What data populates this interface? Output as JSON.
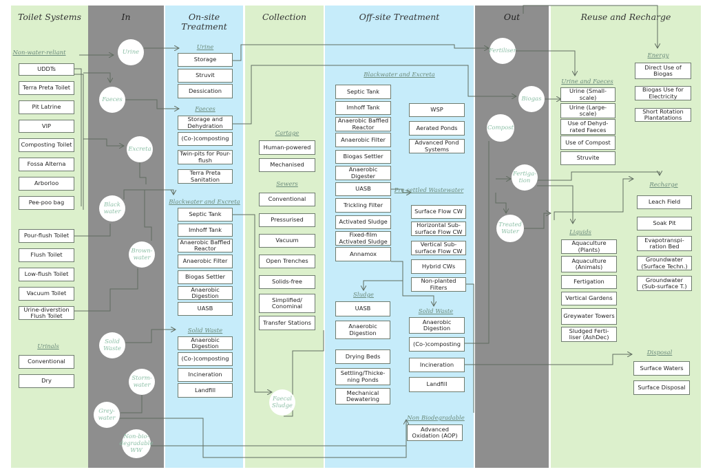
{
  "columns": [
    {
      "title": "Toilet Systems"
    },
    {
      "title": "In"
    },
    {
      "title": "On-site Treatment"
    },
    {
      "title": "Collection"
    },
    {
      "title": "Off-site Treatment"
    },
    {
      "title": "Out"
    },
    {
      "title": "Reuse and Recharge"
    }
  ],
  "groups": [
    {
      "header": "Non-water-reliant",
      "items": [
        "UDDTs",
        "Terra Preta Toilet",
        "Pit Latrine",
        "VIP",
        "Composting Toilet",
        "Fossa Alterna",
        "Arborloo",
        "Pee-poo bag"
      ]
    },
    {
      "header": "",
      "items": [
        "Pour-flush Toilet",
        "Flush Toilet",
        "Low-flush Toilet",
        "Vacuum Toilet",
        "Urine-diverstion Flush Toilet"
      ]
    },
    {
      "header": "Urinals",
      "items": [
        "Conventional",
        "Dry"
      ]
    },
    {
      "header": "Urine",
      "items": [
        "Storage",
        "Struvit",
        "Dessication"
      ]
    },
    {
      "header": "Faeces",
      "items": [
        "Storage and Dehydration",
        "(Co-)composting",
        "Twin-pits for Pour-flush",
        "Terra Preta Sanitation"
      ]
    },
    {
      "header": "Blackwater and Excreta",
      "items": [
        "Septic Tank",
        "Imhoff Tank",
        "Anaerobic Baffled Reactor",
        "Anaerobic Filter",
        "Biogas Settler",
        "Anaerobic Digestion",
        "UASB"
      ]
    },
    {
      "header": "Solid Waste",
      "items": [
        "Anaerobic Digestion",
        "(Co-)composting",
        "Incineration",
        "Landfill"
      ]
    },
    {
      "header": "Cartage",
      "items": [
        "Human-powered",
        "Mechanised"
      ]
    },
    {
      "header": "Sewers",
      "items": [
        "Conventional",
        "Pressurised",
        "Vacuum",
        "Open Trenches",
        "Solids-free",
        "Simplified/ Conominal",
        "Transfer Stations"
      ]
    },
    {
      "header": "Blackwater and Excreta",
      "items": [
        "Septic Tank",
        "Imhoff Tank",
        "Anaerobic Baffled Reactor",
        "Anaerobic Filter",
        "Biogas Settler",
        "Anaerobic Digester",
        "UASB",
        "Trickling Filter",
        "Activated Sludge",
        "Fixed-film Activated Sludge",
        "Annamox"
      ]
    },
    {
      "header": "",
      "items": [
        "WSP",
        "Aerated Ponds",
        "Advanced Pond Systems"
      ]
    },
    {
      "header": "Pre-settled Wastewater",
      "items": [
        "Surface Flow CW",
        "Horizontal Sub-surface Flow CW",
        "Vertical Sub-surface Flow CW",
        "Hybrid CWs",
        "Non-planted Filters"
      ]
    },
    {
      "header": "Sludge",
      "items": [
        "UASB",
        "Anaerobic Digestion",
        "Drying Beds",
        "Settling/Thicke-ning Ponds",
        "Mechanical Dewatering"
      ]
    },
    {
      "header": "Solid Waste",
      "items": [
        "Anaerobic Digestion",
        "(Co-)composting",
        "Incineration",
        "Landfill"
      ]
    },
    {
      "header": "Non Biodegradable",
      "items": [
        "Advanced Oxidation (AOP)"
      ]
    },
    {
      "header": "Urine and Faeces",
      "items": [
        "Urine (Small-scale)",
        "Urine (Large-scale)",
        "Use of Dehyd-rated Faeces",
        "Use of Compost",
        "Struvite"
      ]
    },
    {
      "header": "Energy",
      "items": [
        "Direct Use of Biogas",
        "Biogas Use for Electricity",
        "Short Rotation Plantatations"
      ]
    },
    {
      "header": "Liquids",
      "items": [
        "Aquaculture (Plants)",
        "Aquaculture (Animals)",
        "Fertigation",
        "Vertical Gardens",
        "Greywater Towers",
        "Sludged Ferti-liser (AshDec)"
      ]
    },
    {
      "header": "Recharge",
      "items": [
        "Leach Field",
        "Soak Pit",
        "Evapotranspi-ration Bed",
        "Groundwater (Surface Techn.)",
        "Groundwater (Sub-surface T.)"
      ]
    },
    {
      "header": "Disposal",
      "items": [
        "Surface Waters",
        "Surface Disposal"
      ]
    }
  ],
  "circles": [
    "Urine",
    "Faeces",
    "Excreta",
    "Black water",
    "Brown-water",
    "Solid Waste",
    "Storm-water",
    "Grey-water",
    "Non-bio-degradable WW",
    "Faecal Sludge",
    "Fertiliser",
    "Biogas",
    "Compost",
    "Fertiga-tion",
    "Treated Water"
  ],
  "colors": {
    "reuse_green": "#dcf0cc",
    "flow_grey": "#8e8e8e",
    "treatment_blue": "#c6ecfa",
    "circle_text": "#8cbfa6",
    "line": "#5f6b5f"
  }
}
